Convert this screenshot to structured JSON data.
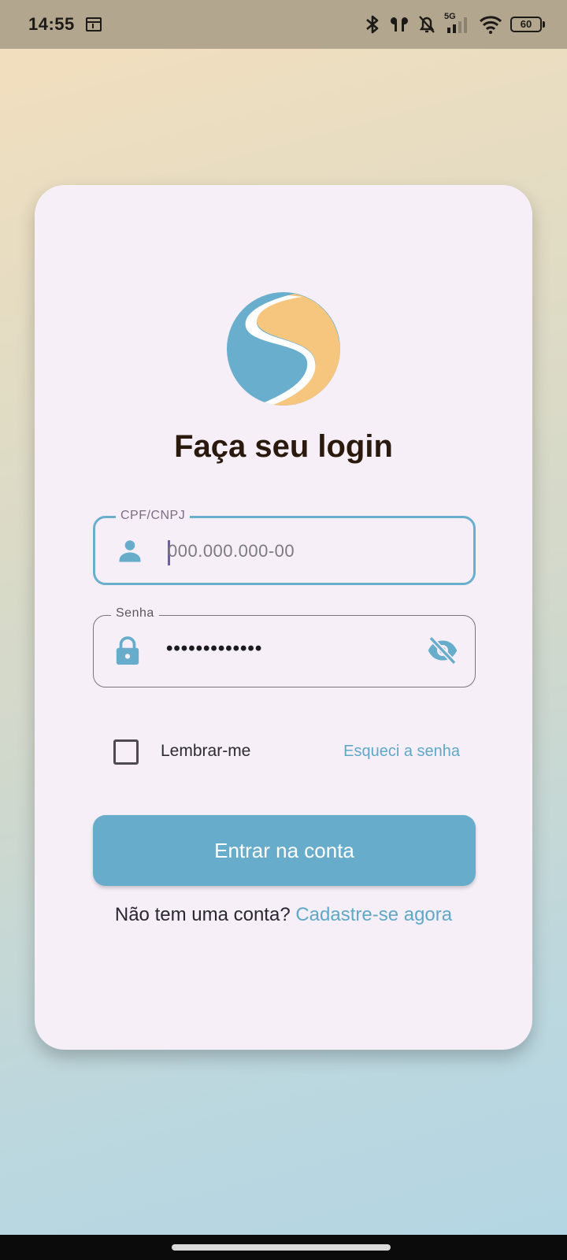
{
  "status_bar": {
    "time": "14:55",
    "network_type": "5G",
    "battery_level": "60",
    "icons": [
      "calendar-icon",
      "bluetooth-icon",
      "earbuds-icon",
      "bell-off-icon",
      "signal-icon",
      "wifi-icon",
      "battery-icon"
    ]
  },
  "login": {
    "title": "Faça seu login",
    "cpf_field": {
      "label": "CPF/CNPJ",
      "placeholder": "000.000.000-00",
      "icon": "person-icon"
    },
    "password_field": {
      "label": "Senha",
      "masked_value": "•••••••••••••",
      "icon": "lock-icon",
      "toggle_icon": "eye-off-icon"
    },
    "remember_label": "Lembrar-me",
    "forgot_password": "Esqueci a senha",
    "submit_label": "Entrar na conta",
    "signup_prompt": "Não tem uma conta?",
    "signup_link": "Cadastre-se agora"
  },
  "colors": {
    "accent": "#67adcb",
    "logo_blue": "#6aaece",
    "logo_orange": "#f6c67f",
    "title": "#2a1a0e",
    "card": "#f6eff8"
  }
}
